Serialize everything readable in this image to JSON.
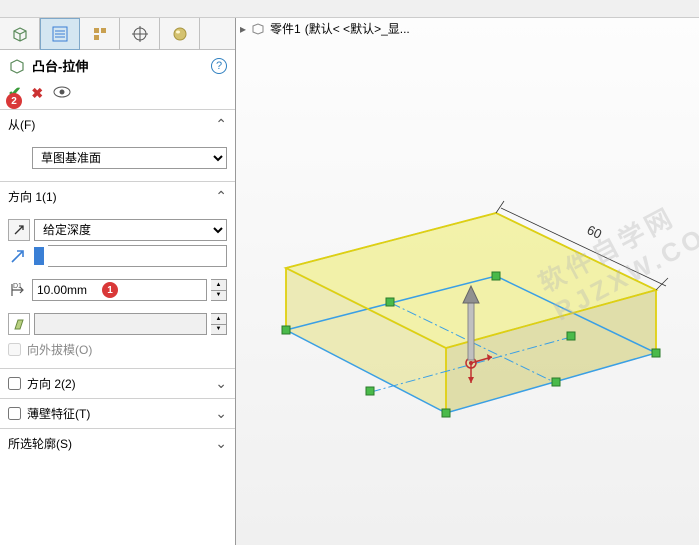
{
  "breadcrumb": {
    "part_label": "零件1",
    "state": "(默认< <默认>_显..."
  },
  "feature": {
    "title": "凸台-拉伸",
    "badge2": "2"
  },
  "from": {
    "label": "从(F)",
    "option": "草图基准面"
  },
  "dir1": {
    "label": "方向 1(1)",
    "end_condition": "给定深度",
    "depth": "10.00mm",
    "badge1": "1",
    "draft_outward": "向外拔模(O)"
  },
  "dir2": {
    "label": "方向 2(2)"
  },
  "thin": {
    "label": "薄壁特征(T)"
  },
  "contours": {
    "label": "所选轮廓(S)"
  },
  "dim": "60",
  "watermark": "软件自学网 RJZXW.COM"
}
